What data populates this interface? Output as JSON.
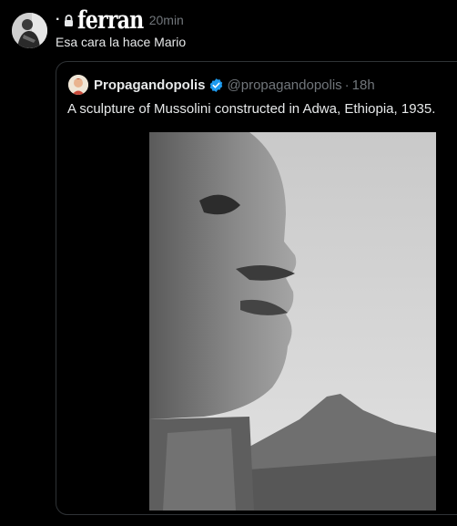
{
  "post": {
    "prefix": "·",
    "display_name": "ferran",
    "timestamp": "20min",
    "text": "Esa cara la hace Mario",
    "icons": {
      "avatar": "person-avatar",
      "lock": "lock-icon"
    }
  },
  "quote": {
    "name": "Propagandopolis",
    "handle": "@propagandopolis",
    "separator": "·",
    "time": "18h",
    "text": "A sculpture of Mussolini constructed in Adwa, Ethiopia, 1935.",
    "icons": {
      "verified": "verified-badge-icon",
      "avatar": "propagandopolis-avatar"
    },
    "media_description_hidden": true
  },
  "colors": {
    "background": "#000000",
    "text_primary": "#e7e9ea",
    "text_secondary": "#71767b",
    "border": "#2f3336",
    "verified": "#1d9bf0"
  }
}
